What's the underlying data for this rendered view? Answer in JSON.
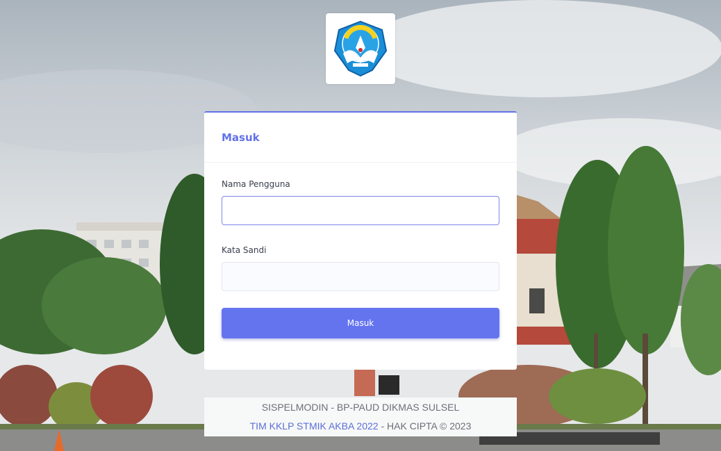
{
  "logo": {
    "name": "tut-wuri-handayani-logo",
    "text": "TUT WURI HANDAYANI"
  },
  "login": {
    "title": "Masuk",
    "username_label": "Nama Pengguna",
    "username_value": "",
    "password_label": "Kata Sandi",
    "password_value": "",
    "submit_label": "Masuk"
  },
  "footer": {
    "line1": "SISPELMODIN - BP-PAUD DIKMAS SULSEL",
    "link_text": "TIM KKLP STMIK AKBA 2022",
    "suffix": " - HAK CIPTA © 2023"
  },
  "colors": {
    "accent": "#6271e8",
    "button": "#6474ef",
    "link": "#5a6fd6"
  }
}
